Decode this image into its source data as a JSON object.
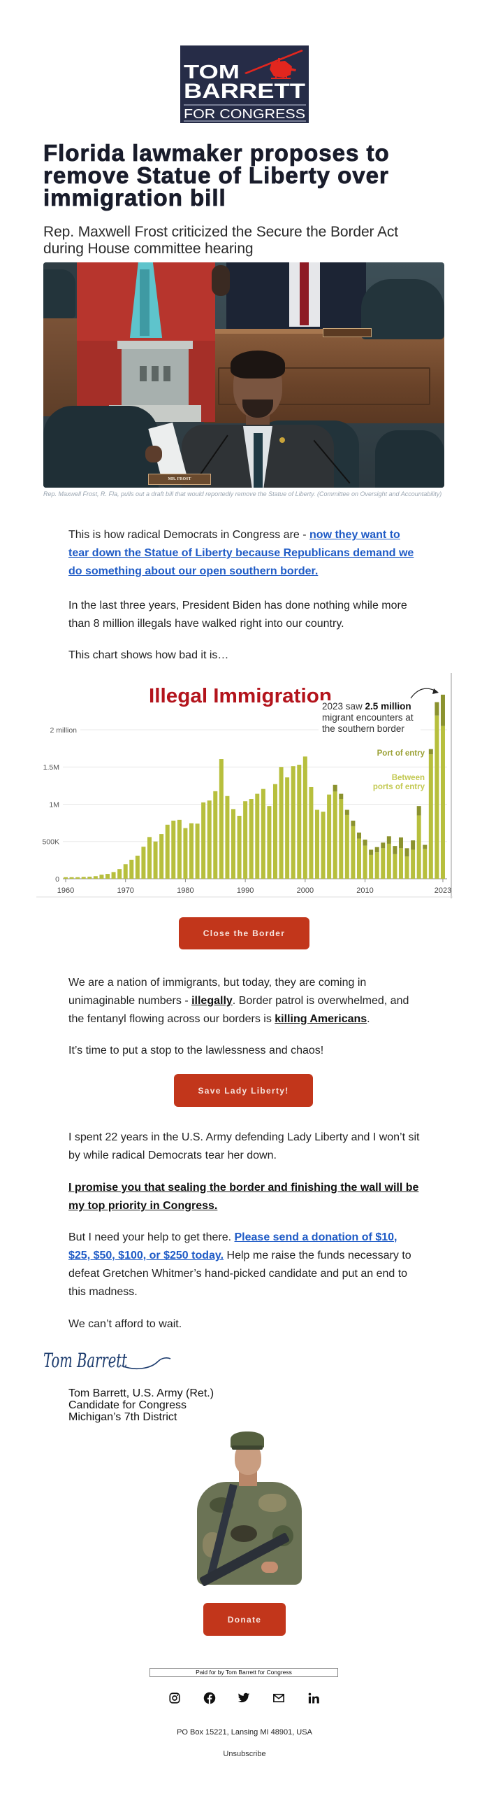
{
  "colors": {
    "button_bg": "#c2361b",
    "link": "#1f5bc6",
    "headline": "#191c2b",
    "logo_bg": "#262c47",
    "logo_accent": "#e2261e"
  },
  "logo": {
    "line1": "TOM",
    "line2": "BARRETT",
    "line3": "FOR CONGRESS",
    "icon": "helicopter-icon"
  },
  "article": {
    "headline": "Florida lawmaker proposes to remove Statue of Liberty over immigration bill",
    "subheadline": "Rep. Maxwell Frost criticized the Secure the Border Act during House committee hearing"
  },
  "photo": {
    "nameplate": "MR. FROST",
    "caption": "Rep. Maxwell Frost, R. Fla, pulls out a draft bill that would reportedly remove the Statue of Liberty. (Committee on Oversight and Accountability)"
  },
  "body": {
    "p1": {
      "text": "This is how radical Democrats in Congress are - ",
      "link": "now they want to tear down the Statue of Liberty because Republicans demand we do something about our open southern border."
    },
    "p2": "In the last three years, President Biden has done nothing while more than 8 million illegals have walked right into our country.",
    "p3": "This chart shows how bad it is…",
    "p4": {
      "t1": "We are a nation of immigrants, but today, they are coming in unimaginable numbers - ",
      "b1": "illegally",
      "t2": ". Border patrol is overwhelmed, and the fentanyl flowing across our borders is ",
      "b2": "killing Americans",
      "t3": "."
    },
    "p5": "It’s time to put a stop to the lawlessness and chaos!",
    "p6": "I spent 22 years in the U.S. Army defending Lady Liberty and I won’t sit by while radical Democrats tear her down.",
    "p7": "I promise you that sealing the border and finishing the wall will be my top priority in Congress.",
    "p8": {
      "t1": "But I need your help to get there. ",
      "link": "Please send a donation of $10, $25, $50, $100, or $250 today.",
      "t2": " Help me raise the funds necessary to defeat Gretchen Whitmer’s hand-picked candidate and put an end to this madness."
    },
    "p9": "We can’t afford to wait."
  },
  "buttons": {
    "close_border": "Close the Border",
    "save_liberty": "Save Lady Liberty!",
    "donate": "Donate"
  },
  "signature": {
    "handwritten": "Tom Barrett",
    "name_line": "Tom Barrett, U.S. Army (Ret.)",
    "title_line": "Candidate for Congress",
    "district_line": "Michigan’s 7th District"
  },
  "footer": {
    "paid_for": "Paid for by Tom Barrett for Congress",
    "social": [
      {
        "name": "Instagram",
        "icon": "instagram-icon"
      },
      {
        "name": "Facebook",
        "icon": "facebook-icon"
      },
      {
        "name": "Twitter",
        "icon": "twitter-icon"
      },
      {
        "name": "Email",
        "icon": "email-icon"
      },
      {
        "name": "LinkedIn",
        "icon": "linkedin-icon"
      }
    ],
    "address": "PO Box 15221, Lansing MI 48901, USA",
    "unsubscribe": "Unsubscribe"
  },
  "chart_data": {
    "type": "bar",
    "stacked": true,
    "title": "Illegal Immigration",
    "xlabel": "",
    "ylabel": "",
    "grid": true,
    "ylim": [
      0,
      2760000
    ],
    "categories": [
      1960,
      1961,
      1962,
      1963,
      1964,
      1965,
      1966,
      1967,
      1968,
      1969,
      1970,
      1971,
      1972,
      1973,
      1974,
      1975,
      1976,
      1977,
      1978,
      1979,
      1980,
      1981,
      1982,
      1983,
      1984,
      1985,
      1986,
      1987,
      1988,
      1989,
      1990,
      1991,
      1992,
      1993,
      1994,
      1995,
      1996,
      1997,
      1998,
      1999,
      2000,
      2001,
      2002,
      2003,
      2004,
      2005,
      2006,
      2007,
      2008,
      2009,
      2010,
      2011,
      2012,
      2013,
      2014,
      2015,
      2016,
      2017,
      2018,
      2019,
      2020,
      2021,
      2022,
      2023
    ],
    "series": [
      {
        "name": "Between ports of entry",
        "color": "#b7bf3d",
        "values": [
          21000,
          21000,
          21000,
          25000,
          28000,
          35000,
          55000,
          65000,
          90000,
          130000,
          195000,
          255000,
          310000,
          430000,
          560000,
          500000,
          600000,
          725000,
          780000,
          790000,
          680000,
          745000,
          740000,
          1025000,
          1050000,
          1175000,
          1605000,
          1110000,
          935000,
          845000,
          1040000,
          1070000,
          1140000,
          1205000,
          975000,
          1270000,
          1500000,
          1360000,
          1510000,
          1530000,
          1640000,
          1230000,
          925000,
          900000,
          1130000,
          1170000,
          1070000,
          855000,
          705000,
          540000,
          445000,
          320000,
          355000,
          410000,
          470000,
          330000,
          410000,
          300000,
          390000,
          850000,
          400000,
          1670000,
          2190000,
          2050000
        ]
      },
      {
        "name": "Port of entry",
        "color": "#8b922e",
        "values": [
          0,
          0,
          0,
          0,
          0,
          0,
          0,
          0,
          0,
          0,
          0,
          0,
          0,
          0,
          0,
          0,
          0,
          0,
          0,
          0,
          0,
          0,
          0,
          0,
          0,
          0,
          0,
          0,
          0,
          0,
          0,
          0,
          0,
          0,
          0,
          0,
          0,
          0,
          0,
          0,
          0,
          0,
          0,
          0,
          0,
          90000,
          70000,
          70000,
          75000,
          80000,
          80000,
          70000,
          70000,
          75000,
          100000,
          110000,
          145000,
          110000,
          125000,
          125000,
          55000,
          70000,
          180000,
          420000
        ]
      }
    ],
    "y_ticks": [
      {
        "value": 0,
        "label": "0"
      },
      {
        "value": 500000,
        "label": "500K"
      },
      {
        "value": 1000000,
        "label": "1M"
      },
      {
        "value": 1500000,
        "label": "1.5M"
      },
      {
        "value": 2000000,
        "label": "2 million"
      }
    ],
    "x_ticks": [
      "1960",
      "1970",
      "1980",
      "1990",
      "2000",
      "2010",
      "2023"
    ],
    "legend": {
      "placement": "right",
      "entries": [
        {
          "lines": [
            "Port of entry"
          ],
          "color": "#9ba136"
        },
        {
          "lines": [
            "Between",
            "ports of entry"
          ],
          "color": "#c3c952"
        }
      ]
    },
    "annotation": {
      "prefix": "2023 saw ",
      "bold": "2.5 million",
      "line2": "migrant encounters at",
      "line3": "the southern border",
      "target_year": 2023
    }
  }
}
